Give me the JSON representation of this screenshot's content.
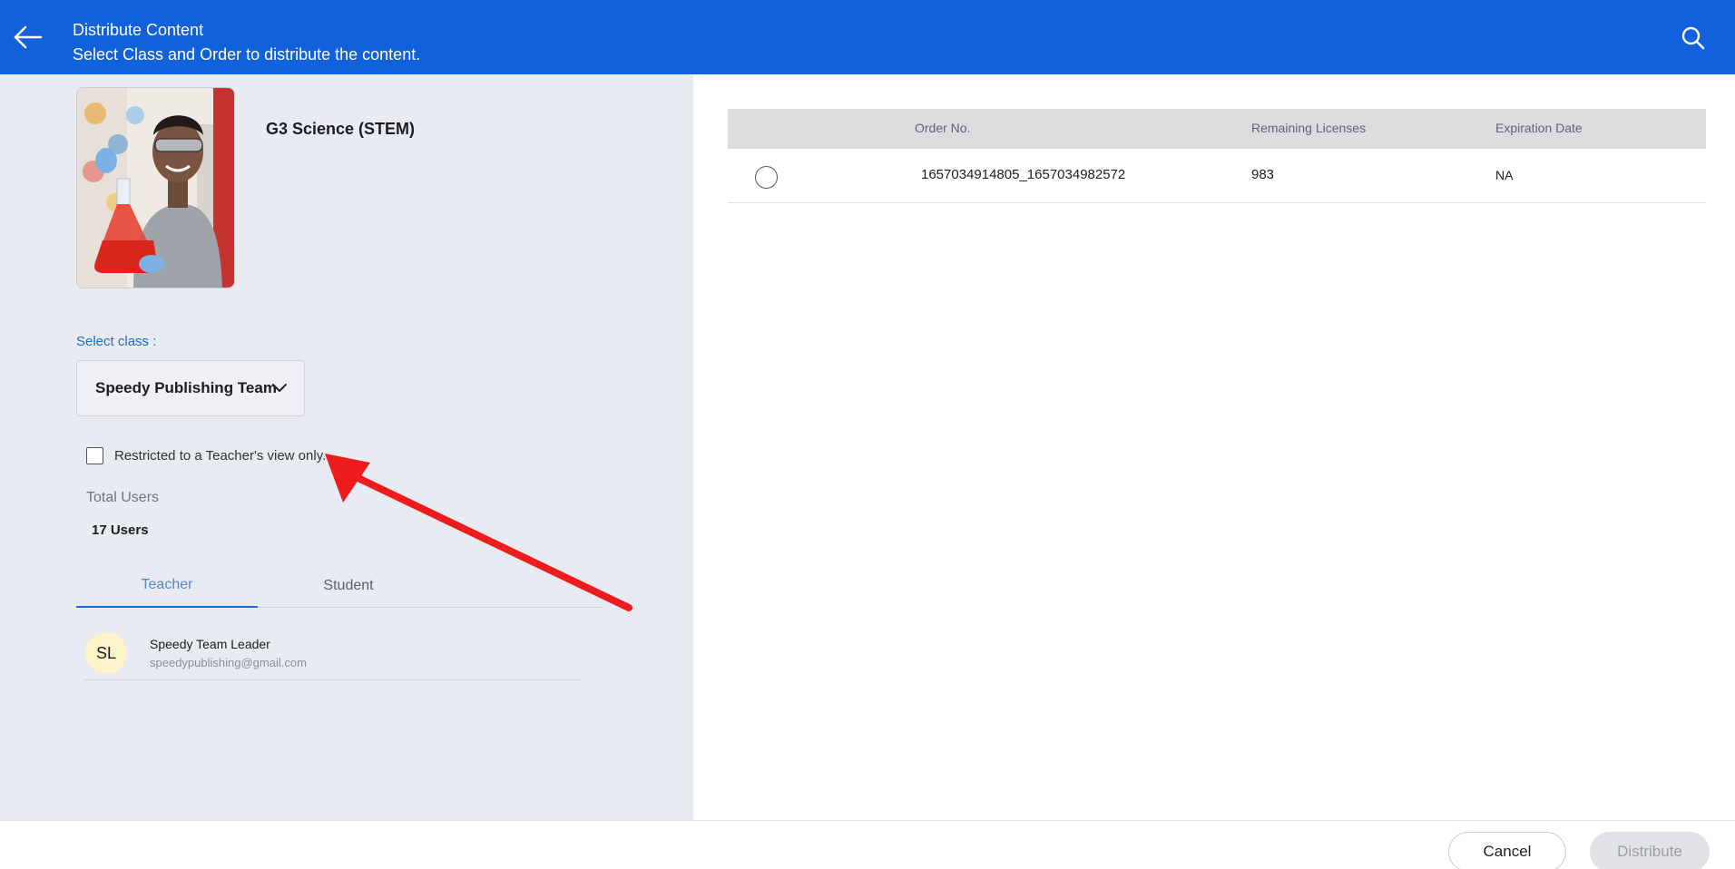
{
  "header": {
    "title": "Distribute Content",
    "subtitle": "Select Class and Order to distribute the content."
  },
  "product": {
    "title": "G3 Science (STEM)"
  },
  "class_select": {
    "label": "Select class :",
    "value": "Speedy Publishing Team"
  },
  "restrict": {
    "label": "Restricted to a Teacher's view only.",
    "checked": false
  },
  "totals": {
    "label": "Total Users",
    "value": "17 Users"
  },
  "tabs": [
    {
      "label": "Teacher",
      "active": true
    },
    {
      "label": "Student",
      "active": false
    }
  ],
  "users": [
    {
      "initials": "SL",
      "name": "Speedy Team Leader",
      "email": "speedypublishing@gmail.com"
    }
  ],
  "orders": {
    "columns": [
      "Order No.",
      "Remaining Licenses",
      "Expiration Date"
    ],
    "rows": [
      {
        "order_no": "1657034914805_1657034982572",
        "remaining": "983",
        "expiration": "NA",
        "selected": false
      }
    ]
  },
  "footer": {
    "cancel_label": "Cancel",
    "distribute_label": "Distribute"
  },
  "colors": {
    "header_bg": "#1160dc",
    "accent": "#1a6ccf",
    "annotation": "#ee1c1c"
  },
  "icons": {
    "back": "arrow-left-icon",
    "search": "search-icon",
    "chevron": "chevron-down-icon"
  }
}
